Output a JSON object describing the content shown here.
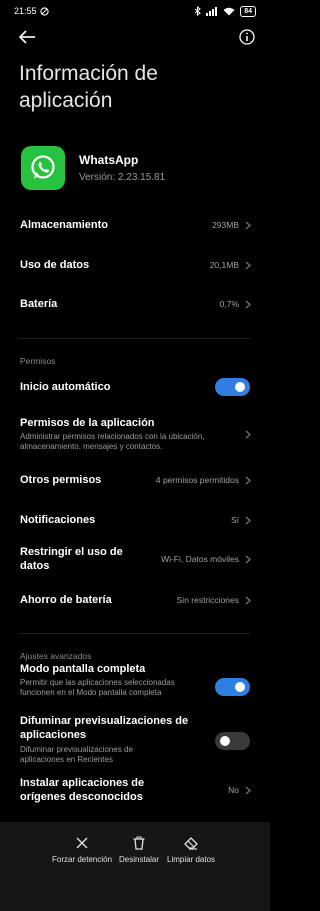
{
  "status": {
    "time": "21:55",
    "battery": "84"
  },
  "title": "Información de aplicación",
  "app": {
    "name": "WhatsApp",
    "version": "Versión: 2.23.15.81"
  },
  "storage_rows": [
    {
      "label": "Almacenamiento",
      "value": "293MB"
    },
    {
      "label": "Uso de datos",
      "value": "20,1MB"
    },
    {
      "label": "Batería",
      "value": "0,7%"
    }
  ],
  "permissions": {
    "section": "Permisos",
    "autostart": {
      "label": "Inicio automático",
      "enabled": true
    },
    "app_permissions": {
      "label": "Permisos de la aplicación",
      "sub": "Administrar permisos relacionados con la ubicación, almacenamiento, mensajes y contactos."
    },
    "other_permissions": {
      "label": "Otros permisos",
      "value": "4 permisos permitidos"
    },
    "notifications": {
      "label": "Notificaciones",
      "value": "Sí"
    },
    "restrict_data": {
      "label": "Restringir el uso de datos",
      "value": "Wi-Fi, Datos móviles"
    },
    "battery_saver": {
      "label": "Ahorro de batería",
      "value": "Sin restricciones"
    }
  },
  "advanced": {
    "section": "Ajustes avanzados",
    "fullscreen": {
      "label": "Modo pantalla completa",
      "sub": "Permitir que las aplicaciones seleccionadas funcionen en el Modo pantalla completa",
      "enabled": true
    },
    "blur": {
      "label": "Difuminar previsualizaciones de aplicaciones",
      "sub": "Difuminar previsualizaciones de aplicaciones en Recientes",
      "enabled": false
    },
    "unknown_sources": {
      "label": "Instalar aplicaciones de orígenes desconocidos",
      "value": "No"
    }
  },
  "actions": {
    "force_stop": "Forzar detención",
    "uninstall": "Desinstalar",
    "clear_data": "Limpiar datos"
  },
  "colors": {
    "accent": "#2f7fe3",
    "whatsapp_green": "#27c23f"
  }
}
